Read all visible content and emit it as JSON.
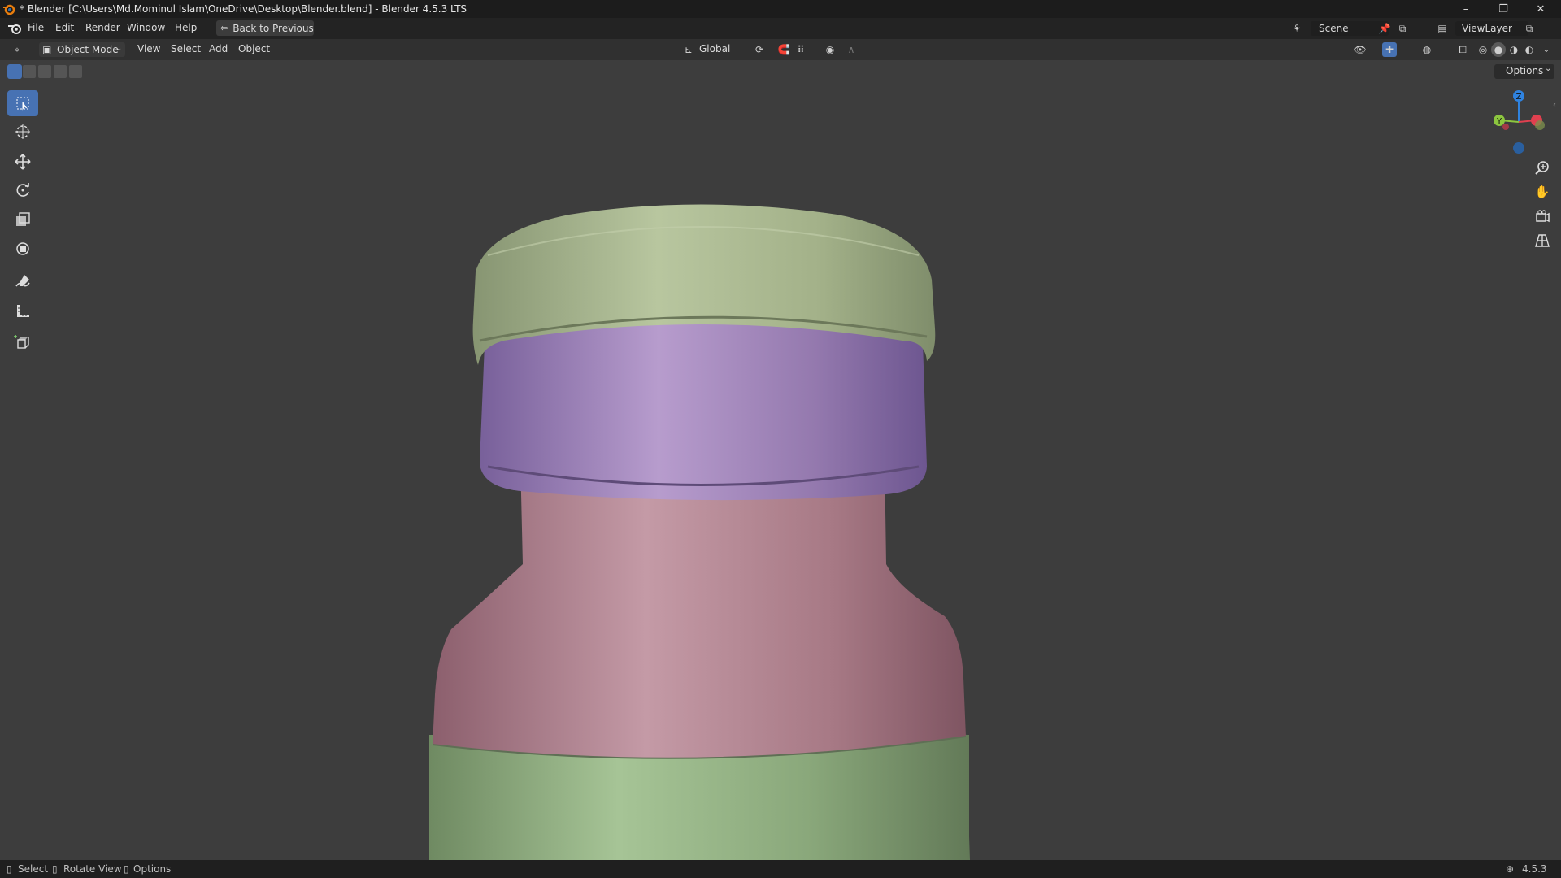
{
  "window": {
    "title": "* Blender [C:\\Users\\Md.Mominul Islam\\OneDrive\\Desktop\\Blender.blend] - Blender 4.5.3 LTS",
    "controls": [
      "–",
      "❐",
      "✕"
    ]
  },
  "menubar": {
    "items": [
      "File",
      "Edit",
      "Render",
      "Window",
      "Help"
    ],
    "back_button": "Back to Previous",
    "scene": "Scene",
    "view_layer": "ViewLayer"
  },
  "header": {
    "mode": "Object Mode",
    "menus": [
      "View",
      "Select",
      "Add",
      "Object"
    ],
    "orientation": "Global",
    "options": "Options"
  },
  "tools": [
    "select-box",
    "cursor",
    "move",
    "rotate",
    "scale",
    "transform",
    "annotate",
    "measure",
    "add-cube"
  ],
  "gizmo": {
    "axes": [
      "Z",
      "Y",
      "X"
    ]
  },
  "statusbar": {
    "select": "Select",
    "rotate": "Rotate View",
    "options": "Options",
    "version": "4.5.3"
  },
  "colors": {
    "cap_green": "#a6b58a",
    "band_purple": "#a58bbd",
    "neck_pink": "#b48694",
    "body_green": "#95b585",
    "viewport": "#3d3d3d",
    "accent": "#4772b3"
  }
}
